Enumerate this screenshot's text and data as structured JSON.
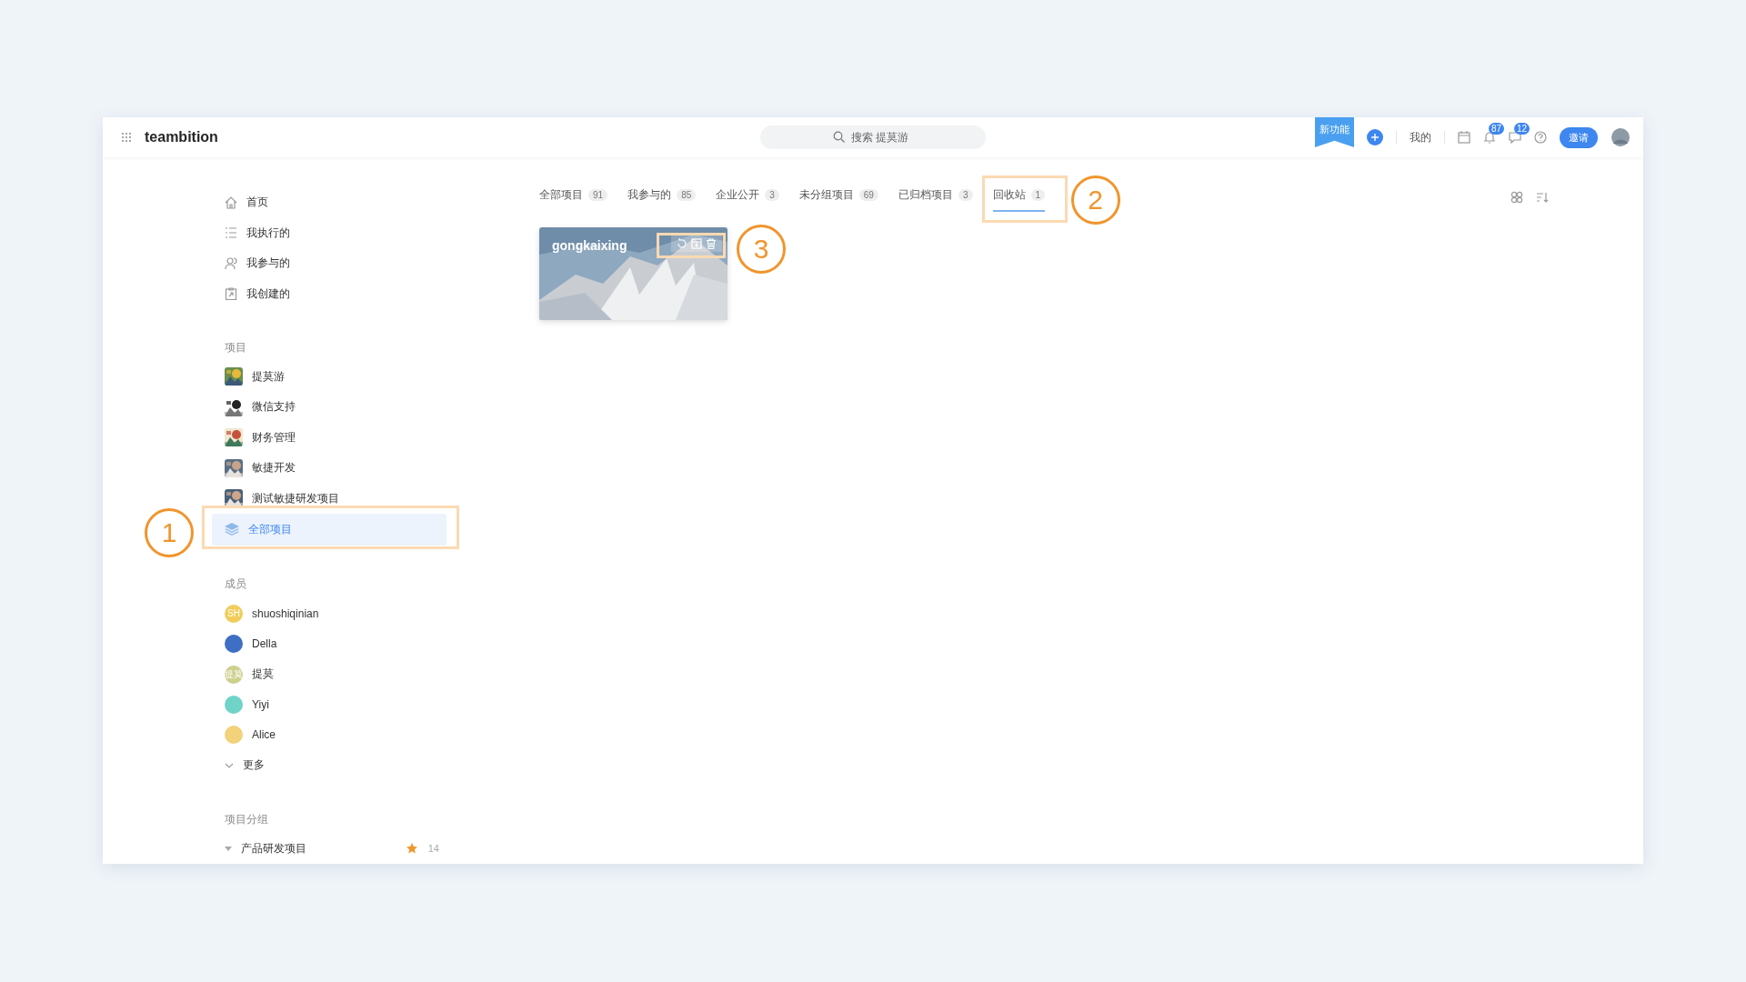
{
  "header": {
    "logo": "teambition",
    "search": {
      "placeholder": "搜索 提莫游"
    },
    "new_feature": "新功能",
    "my": "我的",
    "notifications": [
      {
        "count": "87"
      },
      {
        "count": "12"
      }
    ],
    "invite": "邀请"
  },
  "sidebar": {
    "nav": [
      {
        "label": "首页"
      },
      {
        "label": "我执行的"
      },
      {
        "label": "我参与的"
      },
      {
        "label": "我创建的"
      }
    ],
    "projects": {
      "heading": "项目",
      "items": [
        {
          "label": "提莫游"
        },
        {
          "label": "微信支持"
        },
        {
          "label": "财务管理"
        },
        {
          "label": "敏捷开发"
        },
        {
          "label": "测试敏捷研发项目"
        }
      ],
      "all": {
        "label": "全部项目",
        "selected": true,
        "annotation": "1"
      }
    },
    "members": {
      "heading": "成员",
      "items": [
        {
          "name": "shuoshiqinian",
          "initials": "SH",
          "color": "#f0cd5c"
        },
        {
          "name": "Della",
          "color": "#3f6fc4"
        },
        {
          "name": "提莫",
          "initials": "提莫",
          "color": "#cdd08c"
        },
        {
          "name": "Yiyi",
          "color": "#6fd3c8"
        },
        {
          "name": "Alice",
          "color": "#f2d27a"
        }
      ],
      "more": "更多"
    },
    "groups": {
      "heading": "项目分组",
      "items": [
        {
          "label": "产品研发项目",
          "starred": true,
          "count": "14"
        }
      ]
    }
  },
  "tabs": [
    {
      "label": "全部项目",
      "count": "91",
      "selected": false
    },
    {
      "label": "我参与的",
      "count": "85",
      "selected": false
    },
    {
      "label": "企业公开",
      "count": "3",
      "selected": false
    },
    {
      "label": "未分组项目",
      "count": "69",
      "selected": false
    },
    {
      "label": "已归档项目",
      "count": "3",
      "selected": false
    },
    {
      "label": "回收站",
      "count": "1",
      "selected": true,
      "annotation": "2"
    }
  ],
  "cards": [
    {
      "title": "gongkaixing",
      "kind": "picture",
      "actions_annotation": "3"
    }
  ]
}
